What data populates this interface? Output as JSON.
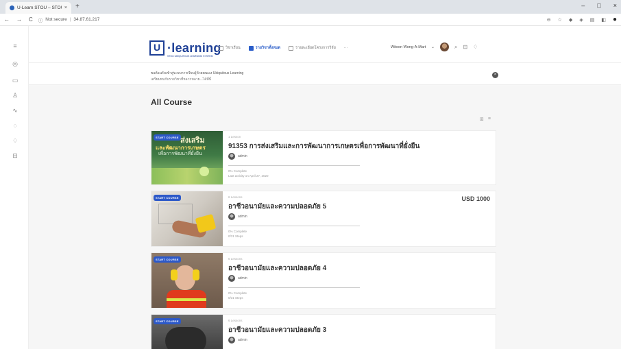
{
  "browser": {
    "tab_title": "U-Learn STOU – STOU",
    "tab_close": "×",
    "new_tab": "+",
    "insecure_label": "Not secure",
    "url": "34.87.61.217",
    "controls": [
      "–",
      "□",
      "×"
    ]
  },
  "header": {
    "logo_mark": "U",
    "logo_word": "·learning",
    "logo_sub": "STOU UBIQUITOUS LEARNING SYSTEM",
    "menu": [
      {
        "label": "วิชาเรียน",
        "active": false
      },
      {
        "label": "รายวิชาทั้งหมด",
        "active": true
      },
      {
        "label": "รายละเอียดโครงการวิจัย",
        "active": false
      },
      {
        "label": "···",
        "active": false
      }
    ],
    "user_name": "Witoon Wong-A-Mart",
    "user_chevron": "⌄"
  },
  "notice": {
    "line1": "ขอต้อนรับเข้าสู่ระบบการเรียนรู้ด้วยตนเอง Ubiquitous Learning",
    "line2": "เตรียมพบกับรายวิชาที่หลากหลาย...ได้ที่นี่",
    "close": "×"
  },
  "main": {
    "title": "All Course",
    "courses": [
      {
        "badge": "START COURSE",
        "lessons": "1 Lesson",
        "title": "91353 การส่งเสริมและการพัฒนาการเกษตรเพื่อการพัฒนาที่ยั่งยืน",
        "author": "admin",
        "progress": "0% Complete",
        "steps": "Last activity on April 27, 2020",
        "price": "",
        "thumb_text1": "ส่งเสริม",
        "thumb_text2": "และพัฒนาการเกษตร",
        "thumb_text3": "เพื่อการพัฒนาที่ยั่งยืน"
      },
      {
        "badge": "START COURSE",
        "lessons": "6 Lessons",
        "title": "อาชีวอนามัยและความปลอดภัย 5",
        "author": "admin",
        "progress": "0% Complete",
        "steps": "0/31 Steps",
        "price": "USD 1000"
      },
      {
        "badge": "START COURSE",
        "lessons": "6 Lessons",
        "title": "อาชีวอนามัยและความปลอดภัย 4",
        "author": "admin",
        "progress": "0% Complete",
        "steps": "0/31 Steps",
        "price": ""
      },
      {
        "badge": "START COURSE",
        "lessons": "6 Lessons",
        "title": "อาชีวอนามัยและความปลอดภัย 3",
        "author": "admin",
        "progress": "",
        "steps": "",
        "price": ""
      }
    ]
  },
  "colors": {
    "brand": "#1d3f96",
    "accent": "#2b5ec9",
    "badge": "#2d59c8"
  }
}
